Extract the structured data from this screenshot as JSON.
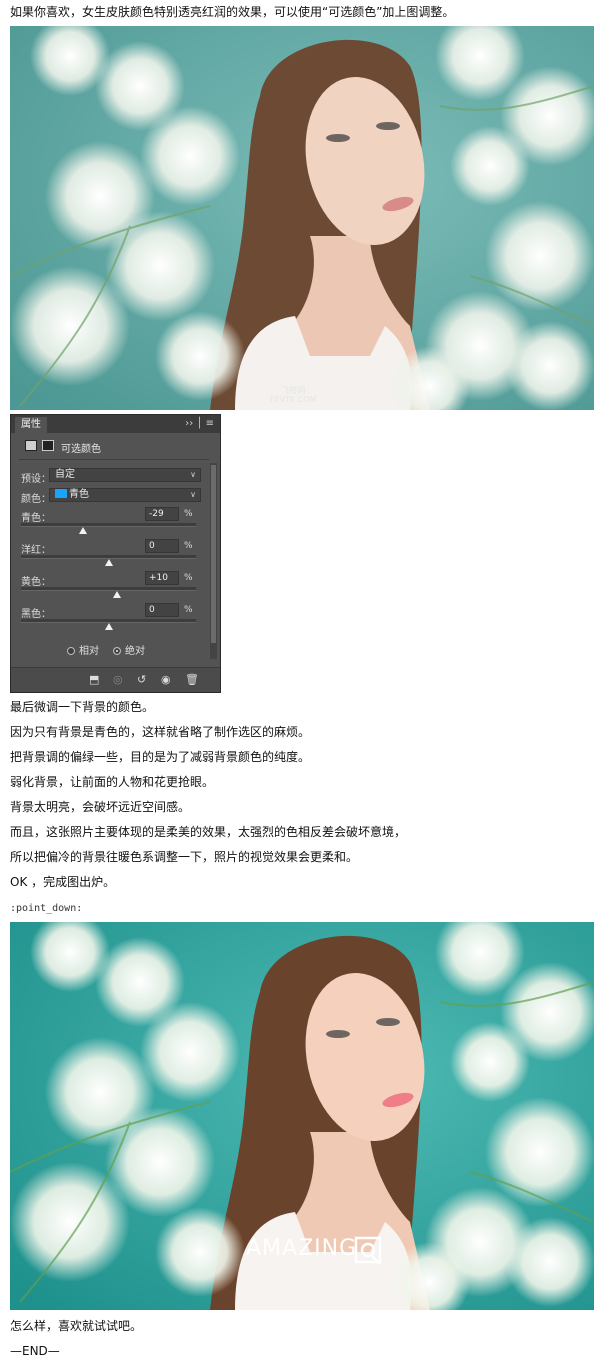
{
  "intro_text": "如果你喜欢，女生皮肤颜色特别透亮红润的效果，可以使用“可选颜色”加上图调整。",
  "photo_top": {
    "watermark": "飞特网\nFEVTE.COM"
  },
  "panel": {
    "tab": "属性",
    "title": "可选颜色",
    "preset_label": "预设：",
    "preset_value": "自定",
    "color_label": "颜色：",
    "color_value": "青色",
    "sliders": [
      {
        "label": "青色：",
        "value": "-29",
        "unit": "%",
        "level": -29
      },
      {
        "label": "洋红：",
        "value": "0",
        "unit": "%",
        "level": 0
      },
      {
        "label": "黄色：",
        "value": "+10",
        "unit": "%",
        "level": 10
      },
      {
        "label": "黑色：",
        "value": "0",
        "unit": "%",
        "level": 0
      }
    ],
    "radio_relative": "相对",
    "radio_absolute": "绝对",
    "selected_mode": "绝对"
  },
  "paragraphs": [
    "最后微调一下背景的颜色。",
    "因为只有背景是青色的，这样就省略了制作选区的麻烦。",
    "把背景调的偏绿一些，目的是为了减弱背景颜色的纯度。",
    "弱化背景，让前面的人物和花更抢眼。",
    "背景太明亮，会破坏远近空间感。",
    "而且，这张照片主要体现的是柔美的效果，太强烈的色相反差会破坏意境，",
    "所以把偏冷的背景往暖色系调整一下，照片的视觉效果会更柔和。",
    "OK ，完成图出炉。"
  ],
  "emoji_code": ":point_down:",
  "photo_bottom": {
    "brand": "AMAZING"
  },
  "outro_text": "怎么样，喜欢就试试吧。",
  "end_text": "—END—",
  "colors": {
    "teal_before": "#5fa9a6",
    "teal_after": "#2aa49f",
    "hair": "#6b4630",
    "skin": "#f1d2c0"
  }
}
